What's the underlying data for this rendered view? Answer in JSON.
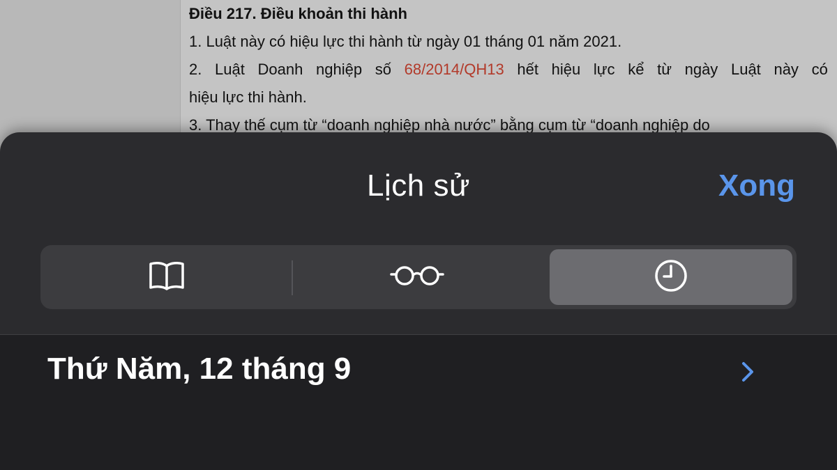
{
  "document": {
    "heading": "Điều 217. Điều khoản thi hành",
    "line1": "1. Luật này có hiệu lực thi hành từ ngày 01 tháng 01 năm 2021.",
    "line2_words_a": [
      "2.",
      "Luật",
      "Doanh",
      "nghiệp",
      "số"
    ],
    "line2_ref": "68/2014/QH13",
    "line2_words_b": [
      "hết",
      "hiệu",
      "lực",
      "kể",
      "từ",
      "ngày",
      "Luật",
      "này",
      "có"
    ],
    "line3": "hiệu lực thi hành.",
    "line4": "3. Thay thế cụm từ “doanh nghiệp nhà nước” bằng cụm từ “doanh nghiệp do"
  },
  "sheet": {
    "title": "Lịch sử",
    "done_label": "Xong"
  },
  "segments": [
    {
      "icon": "book-icon",
      "selected": false
    },
    {
      "icon": "reading-list-glasses-icon",
      "selected": false
    },
    {
      "icon": "history-clock-icon",
      "selected": true
    }
  ],
  "history": {
    "items": [
      {
        "label": "Thứ Năm, 12 tháng 9"
      }
    ]
  },
  "colors": {
    "accent": "#5a95ea",
    "sheet_bg": "#2b2b2e",
    "segment_selected": "#6c6c70",
    "reference_red": "#b23a2a"
  }
}
